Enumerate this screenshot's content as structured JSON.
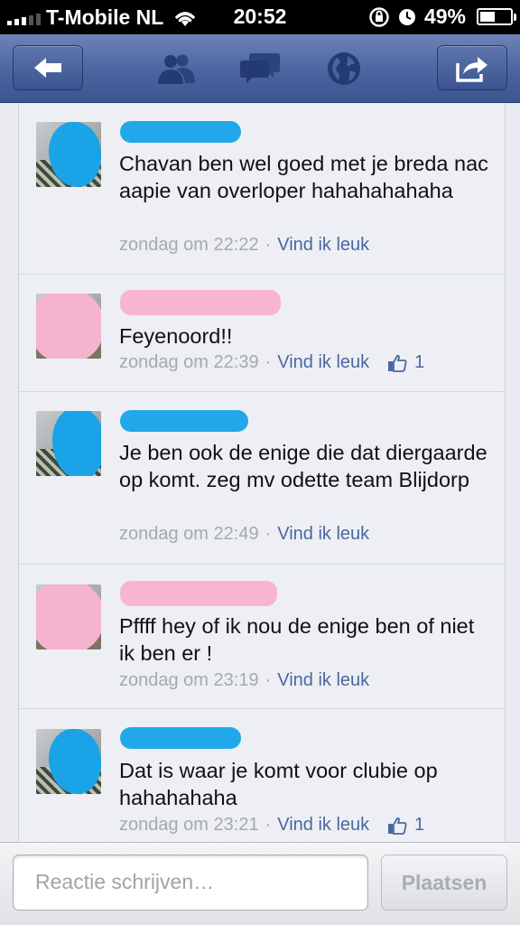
{
  "status_bar": {
    "carrier": "T-Mobile NL",
    "time": "20:52",
    "battery": "49%",
    "battery_level": 0.49
  },
  "nav": {
    "icons": [
      "back-arrow-icon",
      "friends-icon",
      "messages-icon",
      "globe-icon",
      "share-icon"
    ]
  },
  "comments": [
    {
      "name_color": "blue",
      "avatar_cover": "blue",
      "text": "Chavan ben wel goed met je breda nac aapie van overloper hahahahahaha",
      "time": "zondag om 22:22",
      "like_label": "Vind ik leuk",
      "likes": ""
    },
    {
      "name_color": "pink",
      "avatar_cover": "pink",
      "text": "Feyenoord!!",
      "time": "zondag om 22:39",
      "like_label": "Vind ik leuk",
      "likes": "1"
    },
    {
      "name_color": "blue",
      "avatar_cover": "blue",
      "text": "Je ben ook de enige die dat diergaarde op komt. zeg mv odette team Blijdorp",
      "time": "zondag om 22:49",
      "like_label": "Vind ik leuk",
      "likes": ""
    },
    {
      "name_color": "pink",
      "avatar_cover": "pink",
      "text": "Pffff hey of ik nou de enige ben of niet ik ben er !",
      "time": "zondag om 23:19",
      "like_label": "Vind ik leuk",
      "likes": ""
    },
    {
      "name_color": "blue",
      "avatar_cover": "blue",
      "text": "Dat is waar je komt voor clubie op hahahahaha",
      "time": "zondag om 23:21",
      "like_label": "Vind ik leuk",
      "likes": "1"
    }
  ],
  "composer": {
    "placeholder": "Reactie schrijven…",
    "post_label": "Plaatsen"
  },
  "colors": {
    "nav": "#4b64a0",
    "link": "#4b67a1",
    "blur_blue": "#20a8ea",
    "blur_pink": "#f8b5d0"
  }
}
